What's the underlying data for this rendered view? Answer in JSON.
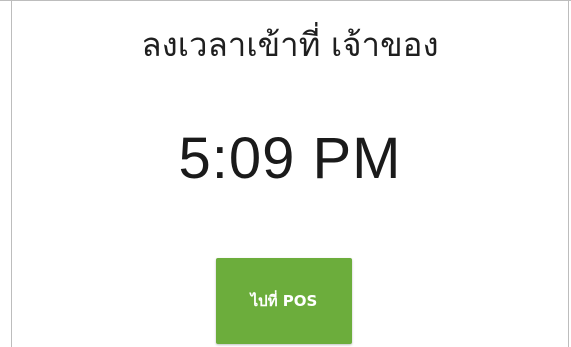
{
  "header": {
    "title": "ลงเวลาเข้าที่ เจ้าของ"
  },
  "clock": {
    "time": "5:09 PM"
  },
  "actions": {
    "go_to_pos_label": "ไปที่ POS"
  },
  "colors": {
    "accent_button": "#6cad3c",
    "text_primary": "#1a1a1a",
    "background": "#ffffff"
  }
}
